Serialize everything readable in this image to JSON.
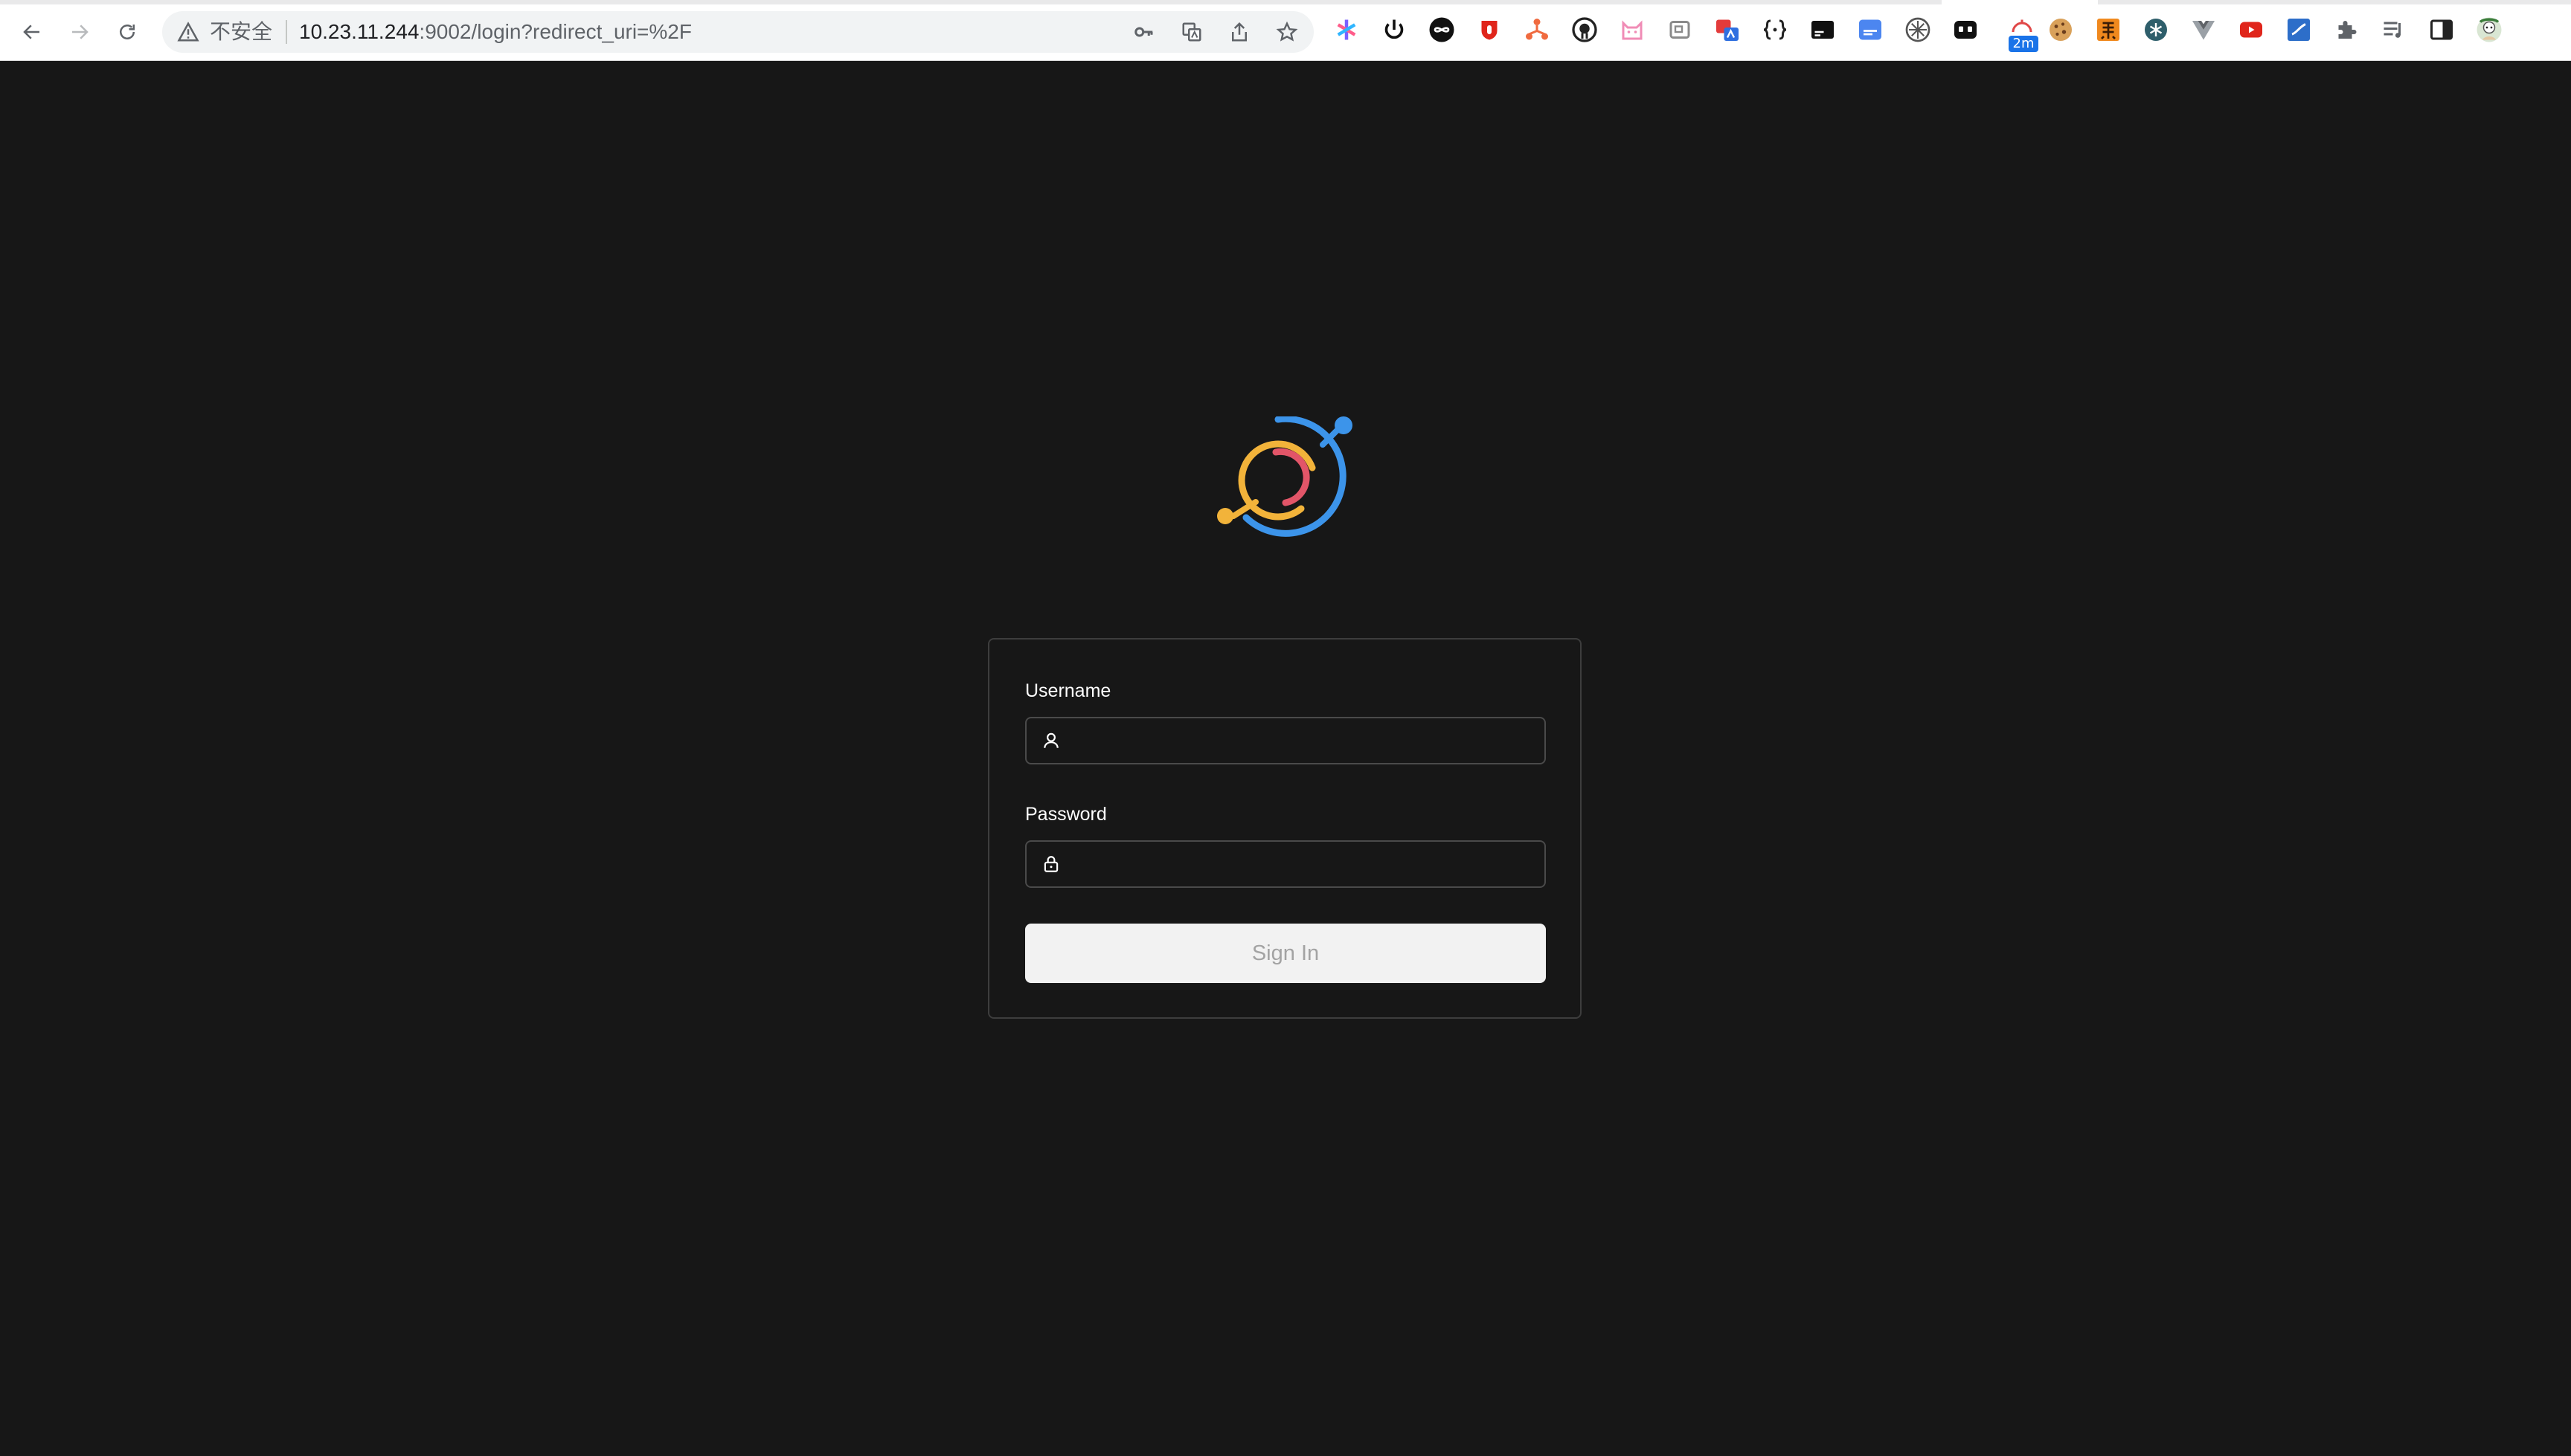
{
  "browser": {
    "security_label": "不安全",
    "url_host": "10.23.11.244",
    "url_path": ":9002/login?redirect_uri=%2F",
    "nav_icons": [
      "back-arrow-icon",
      "forward-arrow-icon",
      "reload-icon"
    ],
    "omnibox_icons": [
      "key-icon",
      "translate-icon",
      "share-icon",
      "bookmark-star-icon"
    ],
    "extension_badge": "2m"
  },
  "login": {
    "logo_icon": "app-logo-icon",
    "logo_colors": {
      "blue": "#3c94ea",
      "yellow": "#f2b33a",
      "red": "#e25568"
    },
    "username_label": "Username",
    "username_value": "",
    "username_icon": "user-icon",
    "password_label": "Password",
    "password_value": "",
    "password_icon": "lock-icon",
    "signin_label": "Sign In"
  }
}
